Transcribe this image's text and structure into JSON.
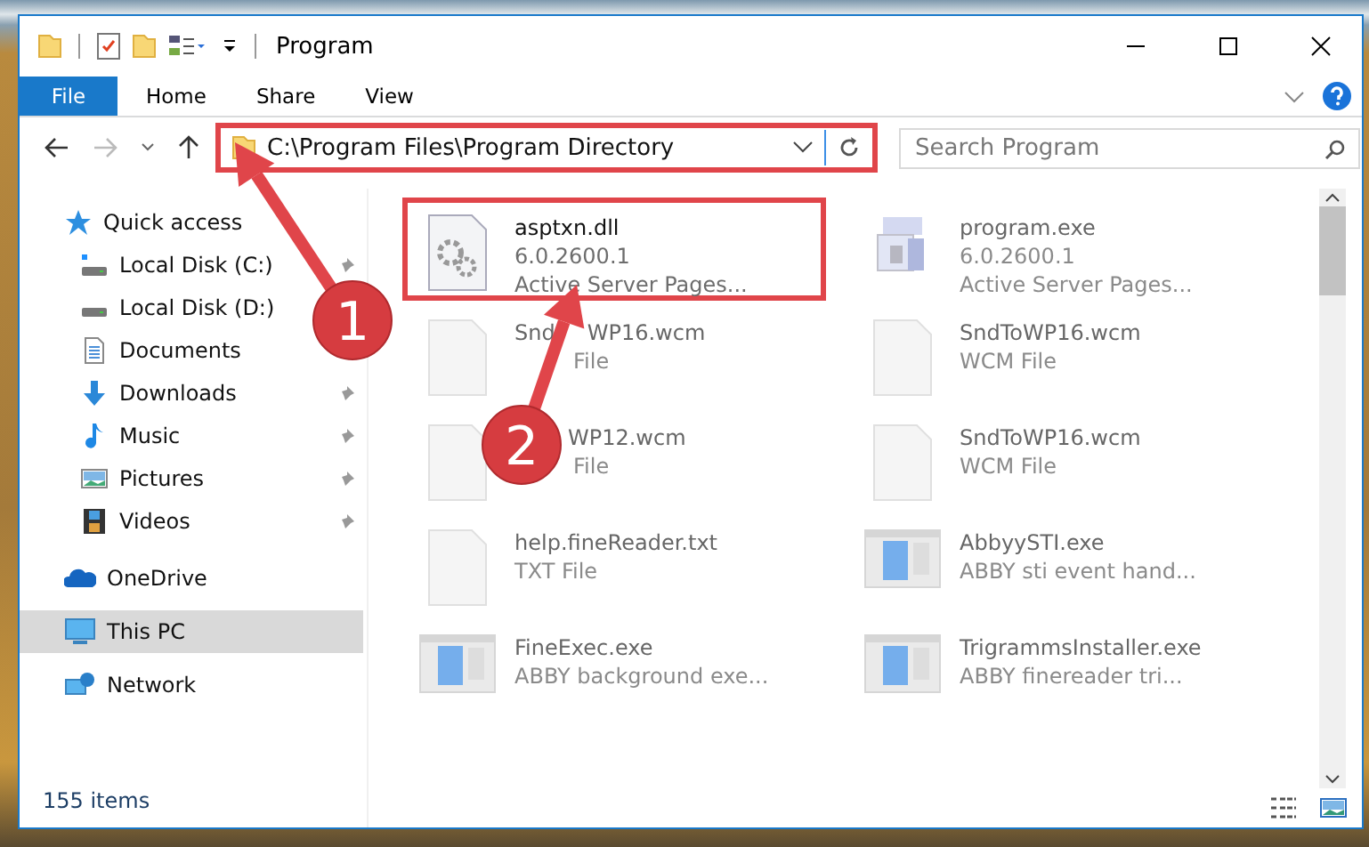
{
  "window": {
    "title": "Program"
  },
  "ribbon": {
    "tabs": [
      {
        "label": "File",
        "kind": "file"
      },
      {
        "label": "Home",
        "kind": "tab"
      },
      {
        "label": "Share",
        "kind": "tab"
      },
      {
        "label": "View",
        "kind": "tab"
      }
    ]
  },
  "address_bar": {
    "path": "C:\\Program Files\\Program Directory",
    "highlighted": true
  },
  "search": {
    "placeholder": "Search Program"
  },
  "sidebar": {
    "items": [
      {
        "label": "Quick access",
        "kind": "star",
        "selected": false,
        "children": [
          {
            "label": "Local Disk (C:)",
            "kind": "windrive",
            "pinned": true
          },
          {
            "label": "Local Disk (D:)",
            "kind": "drive",
            "pinned": false
          },
          {
            "label": "Documents",
            "kind": "documents",
            "pinned": false
          },
          {
            "label": "Downloads",
            "kind": "downloads",
            "pinned": true
          },
          {
            "label": "Music",
            "kind": "music",
            "pinned": true
          },
          {
            "label": "Pictures",
            "kind": "pictures",
            "pinned": true
          },
          {
            "label": "Videos",
            "kind": "videos",
            "pinned": true
          }
        ]
      },
      {
        "label": "OneDrive",
        "kind": "cloud",
        "selected": false
      },
      {
        "label": "This PC",
        "kind": "pc",
        "selected": true
      },
      {
        "label": "Network",
        "kind": "network",
        "selected": false
      }
    ]
  },
  "files": [
    {
      "name": [
        "asptxn.dll"
      ],
      "details": [
        [
          "6.0.2600.1"
        ],
        [
          "Active Server Pages..."
        ]
      ],
      "kind": "dll",
      "faded": false,
      "highlighted": true
    },
    {
      "name": [
        "program.exe"
      ],
      "details": [
        [
          "6.0.2600.1"
        ],
        [
          "Active Server Pages..."
        ]
      ],
      "kind": "program",
      "faded": true,
      "highlighted": false
    },
    {
      "name": [
        "Snd",
        "WP16.wcm"
      ],
      "details": [
        [
          "File"
        ]
      ],
      "kind": "blank",
      "faded": true,
      "highlighted": false
    },
    {
      "name": [
        "SndToWP16.wcm"
      ],
      "details": [
        [
          "WCM File"
        ]
      ],
      "kind": "blank",
      "faded": true,
      "highlighted": false
    },
    {
      "name": [
        "WP12.wcm"
      ],
      "details": [
        [
          "File"
        ]
      ],
      "kind": "blank",
      "faded": true,
      "highlighted": false
    },
    {
      "name": [
        "SndToWP16.wcm"
      ],
      "details": [
        [
          "WCM File"
        ]
      ],
      "kind": "blank",
      "faded": true,
      "highlighted": false
    },
    {
      "name": [
        "help.fineReader.txt"
      ],
      "details": [
        [
          "TXT File"
        ]
      ],
      "kind": "blank",
      "faded": true,
      "highlighted": false
    },
    {
      "name": [
        "AbbyySTI.exe"
      ],
      "details": [
        [
          "ABBY sti event hand..."
        ]
      ],
      "kind": "app",
      "faded": true,
      "highlighted": false
    },
    {
      "name": [
        "FineExec.exe"
      ],
      "details": [
        [
          "ABBY background exe..."
        ]
      ],
      "kind": "app",
      "faded": true,
      "highlighted": false
    },
    {
      "name": [
        "TrigrammsInstaller.exe"
      ],
      "details": [
        [
          "ABBY finereader tri..."
        ]
      ],
      "kind": "app",
      "faded": true,
      "highlighted": false
    }
  ],
  "status_bar": {
    "item_count": "155 items"
  },
  "callouts": [
    {
      "number": "1"
    },
    {
      "number": "2"
    }
  ]
}
